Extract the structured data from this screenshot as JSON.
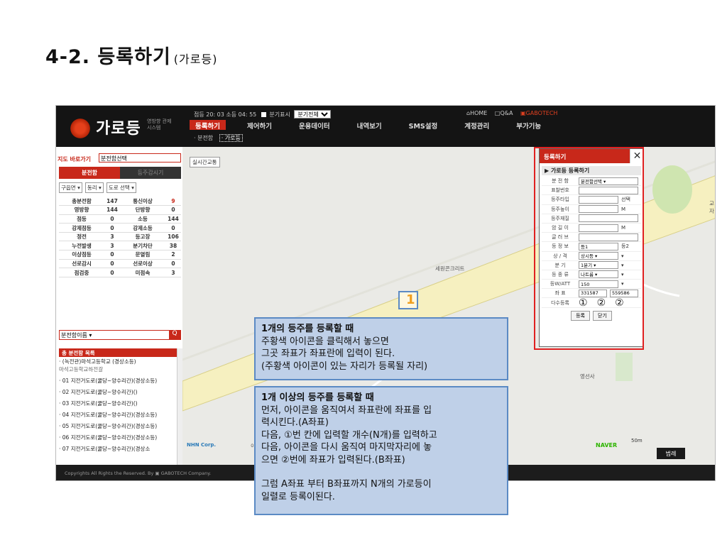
{
  "slide": {
    "title": "4-2. 등록하기",
    "title_suffix": "(가로등)"
  },
  "app": {
    "logo": {
      "text": "가로등",
      "sub": "영방향 관제시스템"
    },
    "util": {
      "text": "점등 20: 03 소등 04: 55",
      "chk_label": "분기표시",
      "select": "분기전체"
    },
    "toplinks": {
      "home": "⌂HOME",
      "qa": "□Q&A",
      "gabotech": "▣GABOTECH"
    },
    "nav": [
      "등록하기",
      "제어하기",
      "운용데이터",
      "내역보기",
      "SMS설정",
      "계정관리",
      "부가기능"
    ],
    "subnav": {
      "item1": "· 분전함",
      "item2": "· 가로등"
    },
    "side": {
      "heading": "지도 바로가기",
      "select": "분전함선택",
      "tabs": [
        "분전함",
        "등주감시기"
      ],
      "filters": [
        "구읍면 ▾",
        "동리 ▾",
        "도로 선택 ▾"
      ],
      "stats": [
        [
          "총분전함",
          "147",
          "통신이상",
          "9"
        ],
        [
          "영방향",
          "144",
          "단방향",
          "0"
        ],
        [
          "점등",
          "0",
          "소등",
          "144"
        ],
        [
          "강제점등",
          "0",
          "강제소등",
          "0"
        ],
        [
          "정전",
          "3",
          "등고장",
          "106"
        ],
        [
          "누전발생",
          "3",
          "분기차단",
          "38"
        ],
        [
          "이상점등",
          "0",
          "문열림",
          "2"
        ],
        [
          "선로감시",
          "0",
          "선로이상",
          "0"
        ],
        [
          "점검중",
          "0",
          "미점속",
          "3"
        ]
      ],
      "search": "분전함이름 ▾",
      "search_btn": "Q",
      "list_header": "총 분전함 목록",
      "list": [
        {
          "t": "· (녹전관)마석고등학교 (경상소등)",
          "s": "마석고등학교하전갈"
        },
        {
          "t": "· 01 지전거도로(쿨당~양수리간)(경상소등)",
          "s": ""
        },
        {
          "t": "· 02 지전거도로(쿨당~양수리간)()",
          "s": ""
        },
        {
          "t": "· 03 지전거도로(쿨당~양수리간)()",
          "s": ""
        },
        {
          "t": "· 04 지전거도로(쿨당~양수리간)(경상소등)",
          "s": ""
        },
        {
          "t": "· 05 지전거도로(쿨당~양수리간)(경상소등)",
          "s": ""
        },
        {
          "t": "· 06 지전거도로(쿨당~양수리간)(경상소등)",
          "s": ""
        },
        {
          "t": "· 07 지전거도로(쿨당~양수리간)(경상소",
          "s": ""
        }
      ]
    },
    "map": {
      "btn": "실시간교통",
      "labels": [
        "세원콘크리트",
        "영선사",
        "교자",
        "NHN Corp.",
        "이정",
        "NAVER"
      ],
      "scale": "50m",
      "legend": "범례",
      "marker": "1"
    },
    "footer": "Copyrights All Rights the Reserved. By ▣ GABOTECH Company.",
    "panel": {
      "title": "등록하기",
      "close": "✕",
      "section": "▶ 가로등 등록하기",
      "rows": [
        {
          "k": "분 전 함",
          "v": "분전함선택 ▾"
        },
        {
          "k": "표찰번호",
          "v": ""
        },
        {
          "k": "등주타입",
          "v": "",
          "extra": "선택"
        },
        {
          "k": "등주높이",
          "v": "",
          "extra": "M"
        },
        {
          "k": "등주재질",
          "v": ""
        },
        {
          "k": "암 길 이",
          "v": "",
          "extra": "M"
        },
        {
          "k": "글 러 브",
          "v": ""
        },
        {
          "k": "등 정 보",
          "v": "등1",
          "extra": "등2"
        },
        {
          "k": "상 / 격",
          "v": "상시등 ▾",
          "extra": "▾"
        },
        {
          "k": "분 기",
          "v": "1분기 ▾",
          "extra": "▾"
        },
        {
          "k": "등 종 류",
          "v": "나트륨 ▾",
          "extra": "▾"
        },
        {
          "k": "등W/ATT",
          "v": "150",
          "extra": "▾"
        }
      ],
      "coord": {
        "k": "좌 표",
        "x": "331587",
        "y": "559586"
      },
      "multi": {
        "k": "다수등록",
        "c1": "①",
        "c2": "②",
        "c3": "②"
      },
      "btn_ok": "등록",
      "btn_close": "닫기"
    }
  },
  "callout1": {
    "title": "1개의 등주를 등록할 때",
    "l1": "주황색 아이콘을 클릭해서 놓으면",
    "l2": "그곳 좌표가 좌표란에 입력이 된다.",
    "l3": " (주황색 아이콘이 있는 자리가 등록될 자리)"
  },
  "callout2": {
    "title": "1개 이상의 등주를  등록할 때",
    "l1": "먼저, 아이콘을 움직여서 좌표란에 좌표를 입",
    "l2": "력시킨다.(A좌표)",
    "l3": "다음, ①번 칸에 입력할 개수(N개)를 입력하고",
    "l4": "다음, 아이콘을 다시 움직여 마지막자리에 놓",
    "l5": "으면 ②번에 좌표가 입력된다.(B좌표)",
    "l6": "그럼 A좌표 부터 B좌표까지 N개의 가로등이",
    "l7": "일렬로 등록이된다."
  }
}
